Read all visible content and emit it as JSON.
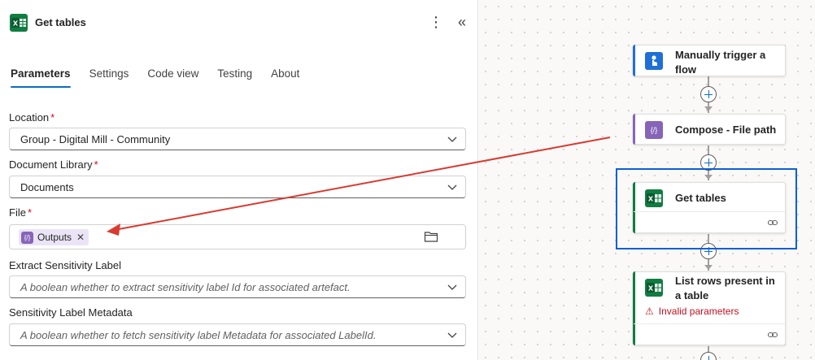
{
  "panel": {
    "title": "Get tables",
    "more_label": "⋮",
    "collapse_label": "«",
    "tabs": [
      {
        "label": "Parameters",
        "active": true
      },
      {
        "label": "Settings",
        "active": false
      },
      {
        "label": "Code view",
        "active": false
      },
      {
        "label": "Testing",
        "active": false
      },
      {
        "label": "About",
        "active": false
      }
    ],
    "fields": {
      "location": {
        "label": "Location",
        "required_mark": "*",
        "value": "Group - Digital Mill - Community"
      },
      "document_library": {
        "label": "Document Library",
        "required_mark": "*",
        "value": "Documents"
      },
      "file": {
        "label": "File",
        "required_mark": "*",
        "token_label": "Outputs",
        "token_icon": "{/}",
        "token_remove": "✕"
      },
      "extract_sensitivity": {
        "label": "Extract Sensitivity Label",
        "placeholder": "A boolean whether to extract sensitivity label Id for associated artefact."
      },
      "sensitivity_metadata": {
        "label": "Sensitivity Label Metadata",
        "placeholder": "A boolean whether to fetch sensitivity label Metadata for associated LabelId."
      }
    }
  },
  "flow": {
    "cards": [
      {
        "title": "Manually trigger a flow",
        "icon": "manual-trigger-icon",
        "accent": "#1f6fd6"
      },
      {
        "title": "Compose - File path",
        "icon": "compose-icon",
        "accent": "#8764b8",
        "icon_text": "{/}"
      },
      {
        "title": "Get tables",
        "icon": "excel-icon",
        "accent": "#107c41"
      },
      {
        "title": "List rows present in a table",
        "icon": "excel-icon",
        "accent": "#107c41",
        "error": "Invalid parameters",
        "error_icon": "⚠"
      }
    ]
  },
  "colors": {
    "excel_green": "#107c41",
    "compose_purple": "#8764b8",
    "trigger_blue": "#1f6fd6",
    "selection_blue": "#0d5fd1",
    "annotation_red": "#d83b31",
    "error_red": "#c50f1f"
  }
}
